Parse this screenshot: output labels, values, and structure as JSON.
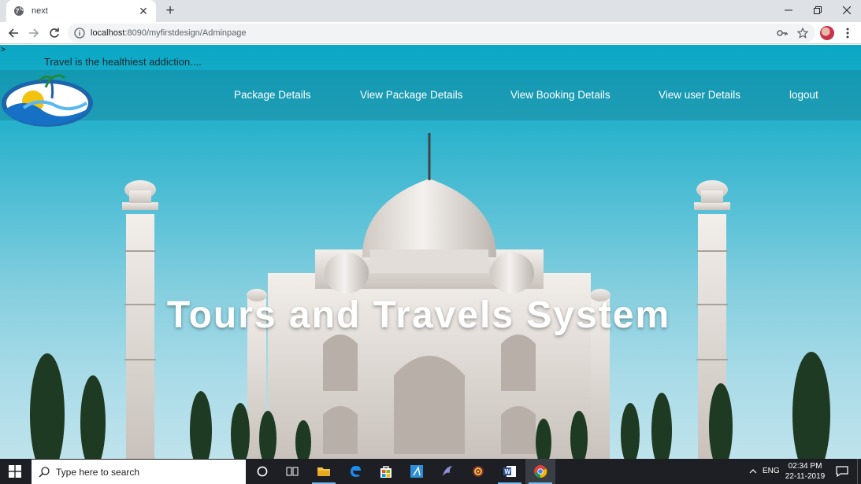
{
  "browser": {
    "tab_title": "next",
    "url_host": "localhost",
    "url_rest": ":8090/myfirstdesign/Adminpage",
    "icons": {
      "favicon": "globe-icon",
      "tab_close": "close-icon",
      "new_tab": "plus-icon",
      "back": "back-arrow-icon",
      "forward": "forward-arrow-icon",
      "reload": "reload-icon",
      "site_info": "info-icon",
      "passwords": "key-icon",
      "bookmark": "star-icon",
      "profile": "avatar",
      "menu": "kebab-menu-icon",
      "minimize": "minimize-icon",
      "restore": "restore-icon",
      "close_window": "close-icon"
    },
    "colors": {
      "tabstrip": "#dee1e6",
      "omnibox": "#f1f3f4"
    }
  },
  "page": {
    "stray_char": ">",
    "tagline": "Travel is the healthiest addiction....",
    "nav": [
      {
        "label": "Package Details"
      },
      {
        "label": "View Package Details"
      },
      {
        "label": "View Booking Details"
      },
      {
        "label": "View user Details"
      },
      {
        "label": "logout"
      }
    ],
    "hero_title": "Tours and Travels System",
    "colors": {
      "sky": "#29b2cc",
      "navbar": "#14788c",
      "text": "#ffffff"
    }
  },
  "taskbar": {
    "search_placeholder": "Type here to search",
    "language": "ENG",
    "time": "02:34 PM",
    "date": "22-11-2019",
    "apps": [
      "cortana-circle-icon",
      "task-view-icon",
      "file-explorer-icon",
      "edge-icon",
      "store-icon",
      "app-icon",
      "dolphin-app-icon",
      "gear-app-icon",
      "word-icon",
      "chrome-icon"
    ]
  }
}
